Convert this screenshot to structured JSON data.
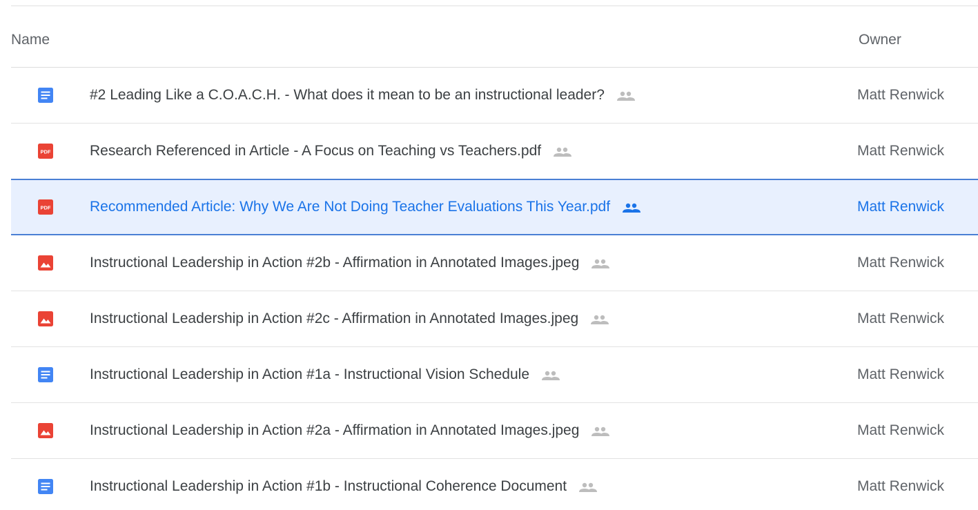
{
  "columns": {
    "name": "Name",
    "owner": "Owner"
  },
  "colors": {
    "doc_icon": "#4285f4",
    "red_icon": "#ea4335",
    "selected_bg": "#e8f0fe",
    "selected_text": "#1a73e8",
    "shared_icon_gray": "#bdbdbd"
  },
  "files": [
    {
      "icon": "google-doc-icon",
      "name": "#2 Leading Like a C.O.A.C.H. - What does it mean to be an instructional leader?",
      "owner": "Matt Renwick",
      "shared": true,
      "selected": false
    },
    {
      "icon": "pdf-icon",
      "name": "Research Referenced in Article - A Focus on Teaching vs Teachers.pdf",
      "owner": "Matt Renwick",
      "shared": true,
      "selected": false
    },
    {
      "icon": "pdf-icon",
      "name": "Recommended Article: Why We Are Not Doing Teacher Evaluations This Year.pdf",
      "owner": "Matt Renwick",
      "shared": true,
      "selected": true
    },
    {
      "icon": "image-icon",
      "name": "Instructional Leadership in Action #2b - Affirmation in Annotated Images.jpeg",
      "owner": "Matt Renwick",
      "shared": true,
      "selected": false
    },
    {
      "icon": "image-icon",
      "name": "Instructional Leadership in Action #2c - Affirmation in Annotated Images.jpeg",
      "owner": "Matt Renwick",
      "shared": true,
      "selected": false
    },
    {
      "icon": "google-doc-icon",
      "name": "Instructional Leadership in Action #1a - Instructional Vision Schedule",
      "owner": "Matt Renwick",
      "shared": true,
      "selected": false
    },
    {
      "icon": "image-icon",
      "name": "Instructional Leadership in Action #2a - Affirmation in Annotated Images.jpeg",
      "owner": "Matt Renwick",
      "shared": true,
      "selected": false
    },
    {
      "icon": "google-doc-icon",
      "name": "Instructional Leadership in Action #1b - Instructional Coherence Document",
      "owner": "Matt Renwick",
      "shared": true,
      "selected": false
    }
  ],
  "pdf_icon_text": "PDF"
}
